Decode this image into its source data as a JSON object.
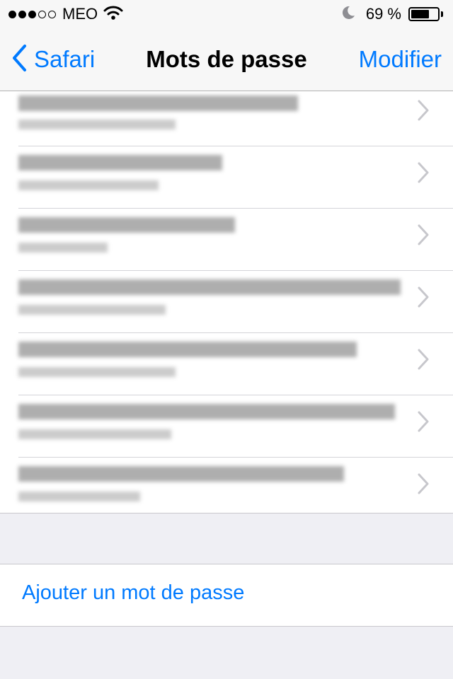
{
  "status_bar": {
    "signal_dots_filled": 3,
    "signal_dots_total": 5,
    "carrier": "MEO",
    "wifi_icon": "wifi-icon",
    "moon_icon": "moon-icon",
    "battery_percent_text": "69 %",
    "battery_level": 0.69
  },
  "nav": {
    "back_label": "Safari",
    "title": "Mots de passe",
    "edit_label": "Modifier"
  },
  "passwords": {
    "item_count": 7,
    "note": "blurred"
  },
  "add_password_label": "Ajouter un mot de passe",
  "colors": {
    "accent": "#007aff",
    "background": "#efeff4",
    "bar_background": "#f7f7f7"
  }
}
